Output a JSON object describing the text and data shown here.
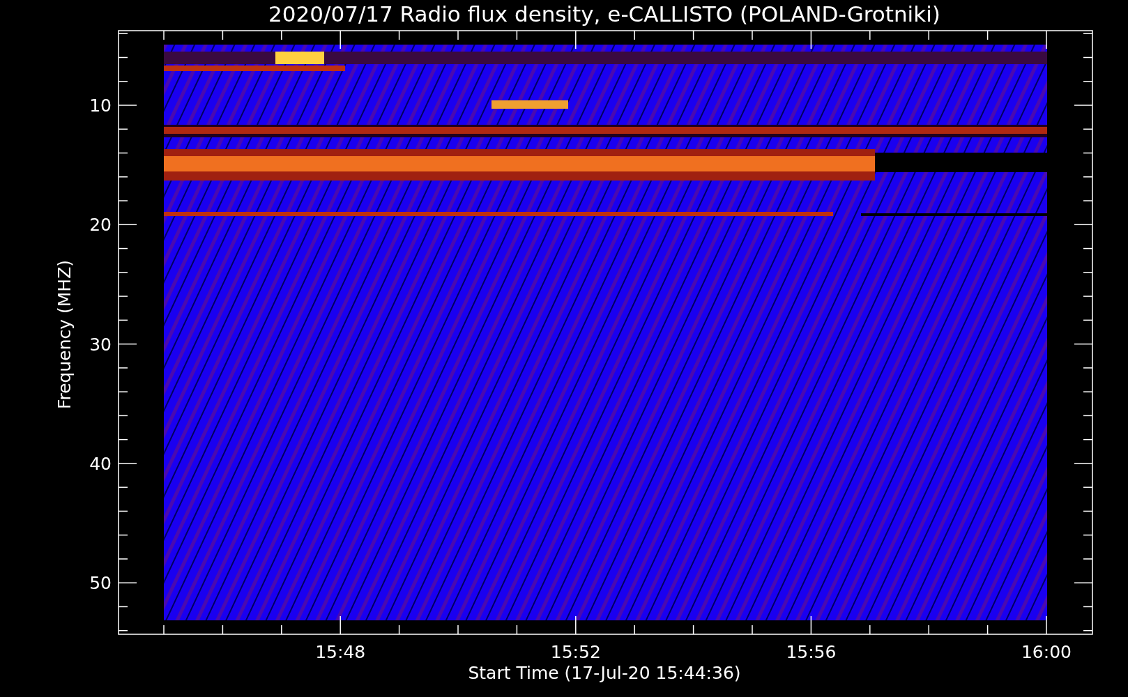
{
  "title": "2020/07/17  Radio flux density, e-CALLISTO (POLAND-Grotniki)",
  "y_axis": {
    "label": "Frequency (MHZ)",
    "ticks": [
      "10",
      "20",
      "30",
      "40",
      "50"
    ]
  },
  "x_axis": {
    "label": "Start Time (17-Jul-20 15:44:36)",
    "ticks": [
      "15:48",
      "15:52",
      "15:56",
      "16:00"
    ]
  }
}
